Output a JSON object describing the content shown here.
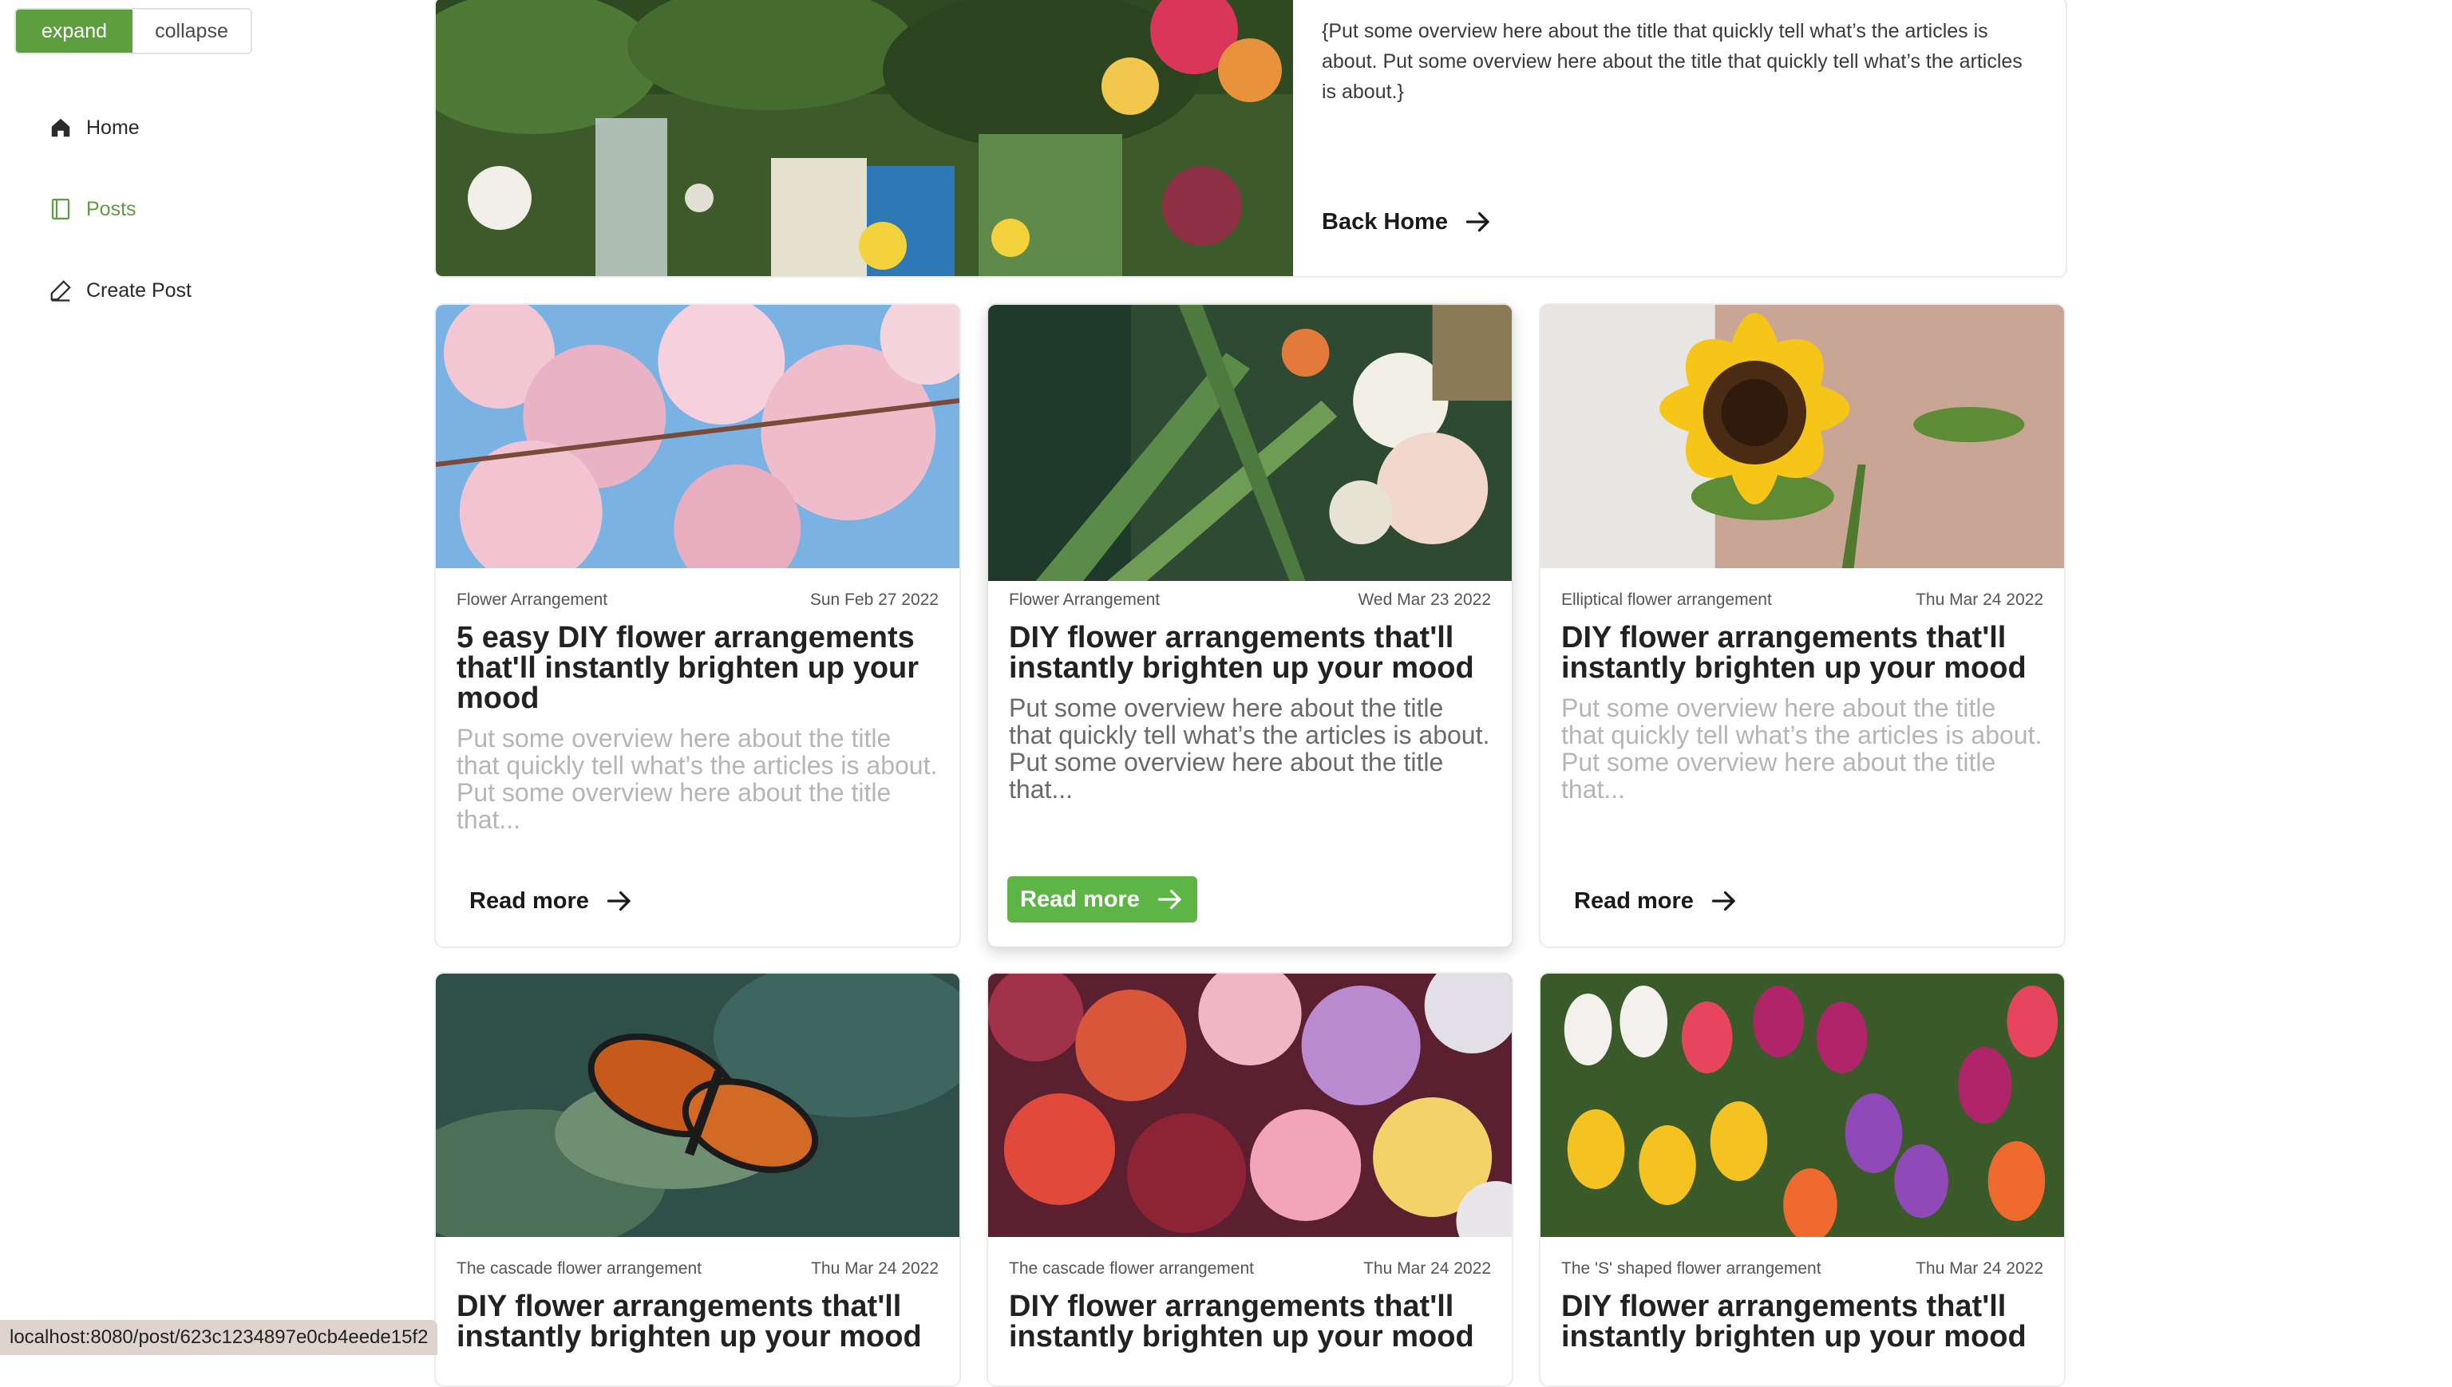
{
  "toggle": {
    "expand": "expand",
    "collapse": "collapse"
  },
  "nav": {
    "home": "Home",
    "posts": "Posts",
    "create": "Create Post"
  },
  "hero": {
    "text": "{Put some overview here about the title that quickly tell what’s the articles is about. Put some overview here about the title that quickly tell what’s the articles is about.}",
    "back_home": "Back Home"
  },
  "cards": [
    {
      "category": "Flower Arrangement",
      "date": "Sun Feb 27 2022",
      "title": "5 easy DIY flower arrangements that'll instantly brighten up your mood",
      "excerpt": "Put some overview here about the title that quickly tell what’s the articles is about. Put some overview here about the title that...",
      "read_more": "Read more"
    },
    {
      "category": "Flower Arrangement",
      "date": "Wed Mar 23 2022",
      "title": "DIY flower arrangements that'll instantly brighten up your mood",
      "excerpt": "Put some overview here about the title that quickly tell what’s the articles is about. Put some overview here about the title that...",
      "read_more": "Read more"
    },
    {
      "category": "Elliptical flower arrangement",
      "date": "Thu Mar 24 2022",
      "title": "DIY flower arrangements that'll instantly brighten up your mood",
      "excerpt": "Put some overview here about the title that quickly tell what’s the articles is about. Put some overview here about the title that...",
      "read_more": "Read more"
    },
    {
      "category": "The cascade flower arrangement",
      "date": "Thu Mar 24 2022",
      "title": "DIY flower arrangements that'll instantly brighten up your mood"
    },
    {
      "category": "The cascade flower arrangement",
      "date": "Thu Mar 24 2022",
      "title": "DIY flower arrangements that'll instantly brighten up your mood"
    },
    {
      "category": "The 'S' shaped flower arrangement",
      "date": "Thu Mar 24 2022",
      "title": "DIY flower arrangements that'll instantly brighten up your mood"
    }
  ],
  "status_url": "localhost:8080/post/623c1234897e0cb4eede15f2",
  "colors": {
    "accent": "#5d9e3f",
    "button_active": "#5db546"
  }
}
